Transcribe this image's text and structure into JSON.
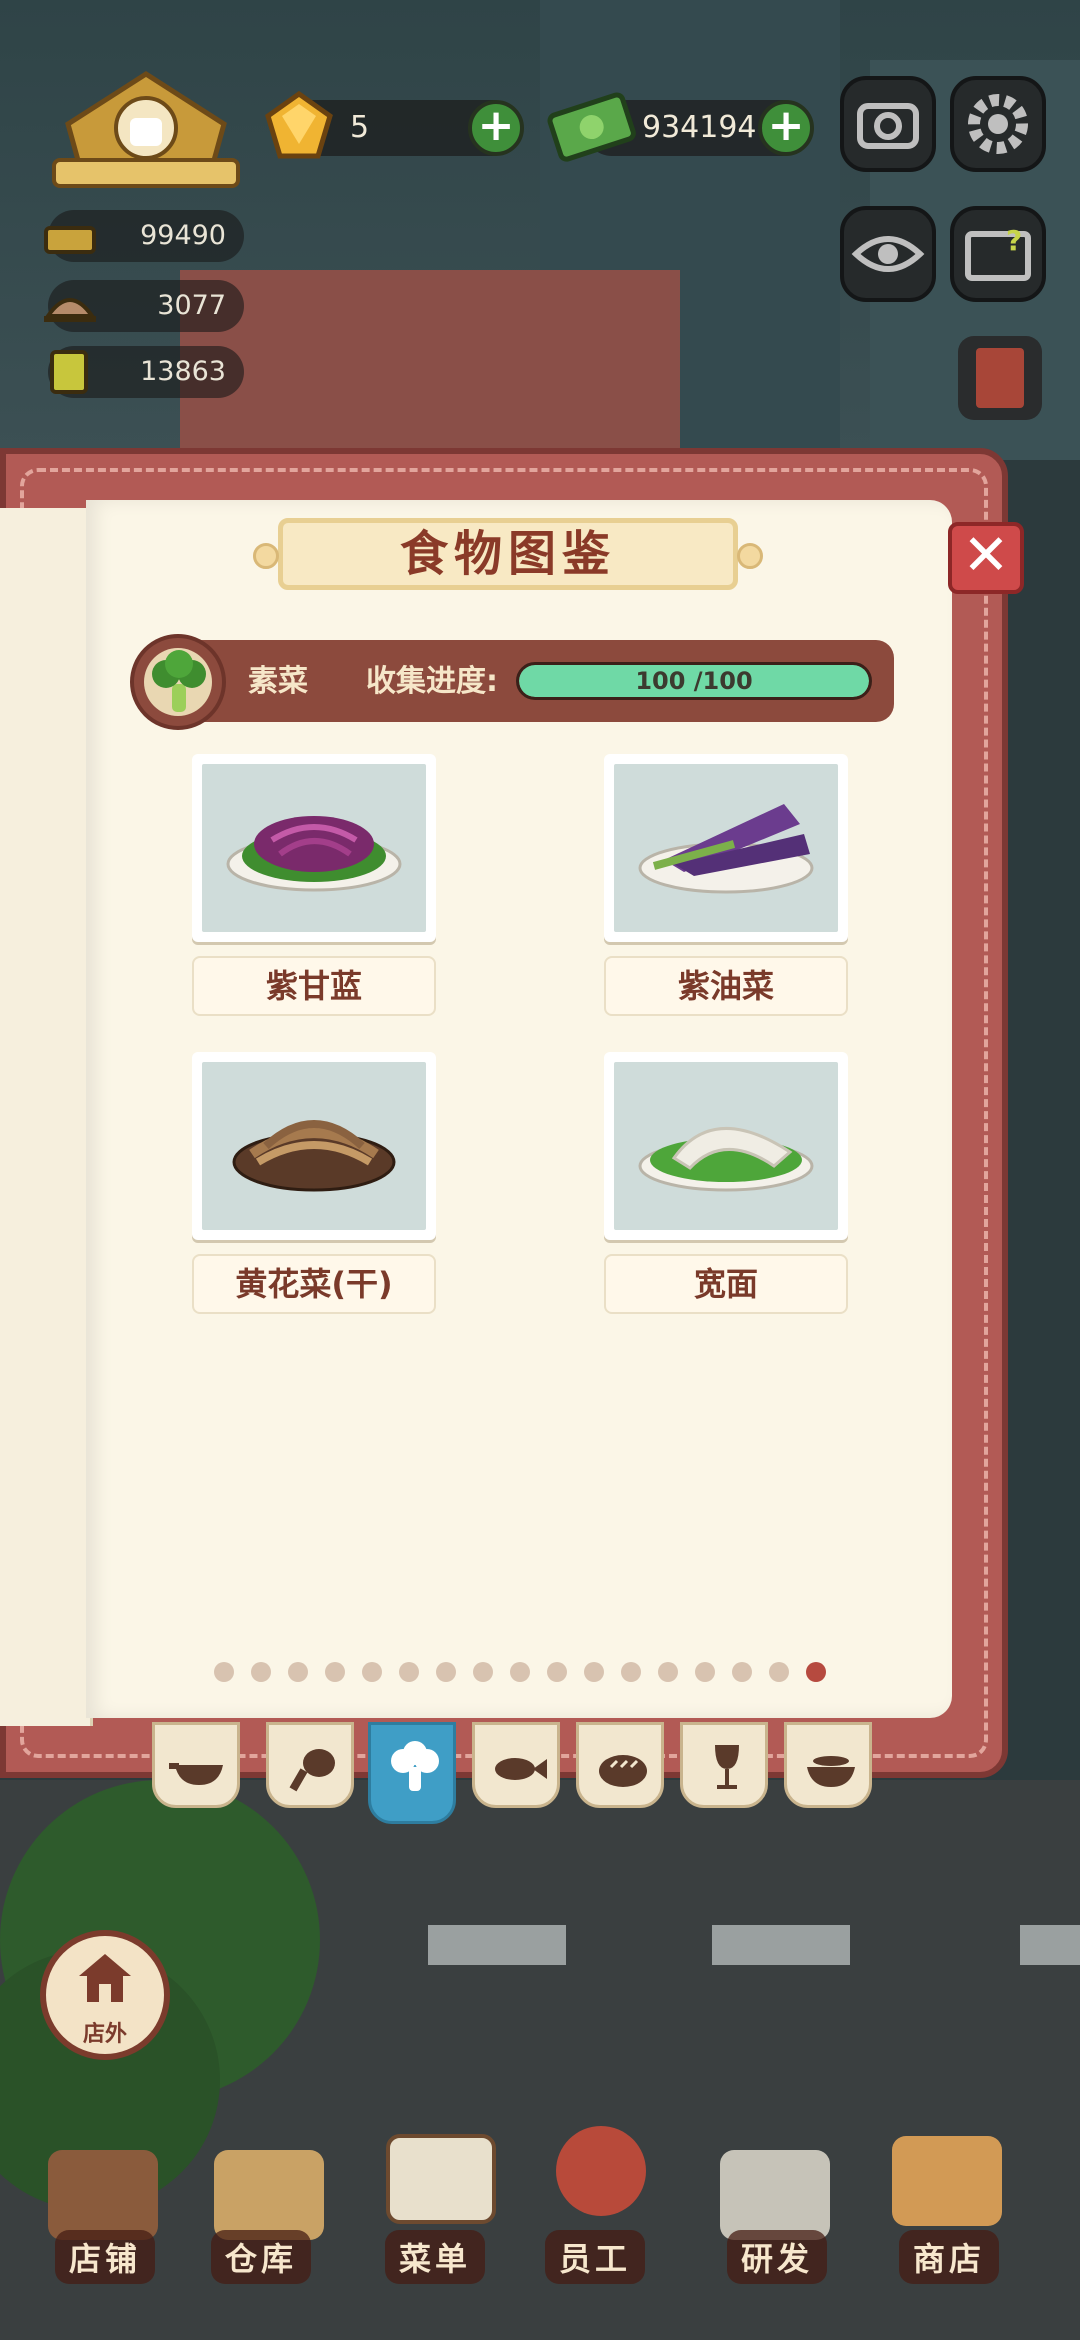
{
  "hud": {
    "gems": "5",
    "cash": "934194",
    "stats": [
      "99490",
      "3077",
      "13863"
    ]
  },
  "book": {
    "title": "食物图鉴",
    "category": "素菜",
    "progress_label": "收集进度:",
    "progress_text": "100 /100",
    "progress_value": 100,
    "progress_max": 100
  },
  "foods": [
    {
      "name": "紫甘蓝"
    },
    {
      "name": "紫油菜"
    },
    {
      "name": "黄花菜(干)"
    },
    {
      "name": "宽面"
    }
  ],
  "pager": {
    "total": 17,
    "active": 17
  },
  "tabs": [
    {
      "icon": "wok-icon"
    },
    {
      "icon": "drumstick-icon"
    },
    {
      "icon": "broccoli-icon",
      "active": true
    },
    {
      "icon": "fish-icon"
    },
    {
      "icon": "bread-icon"
    },
    {
      "icon": "wine-glass-icon"
    },
    {
      "icon": "soup-bowl-icon"
    }
  ],
  "nav": {
    "outside": "店外",
    "items": [
      "店铺",
      "仓库",
      "菜单",
      "员工",
      "研发",
      "商店"
    ]
  },
  "colors": {
    "book_cover": "#b25a55",
    "progress_fill": "#6fd9a6",
    "active_tab": "#3f9ec6",
    "close": "#cf4a4a"
  }
}
